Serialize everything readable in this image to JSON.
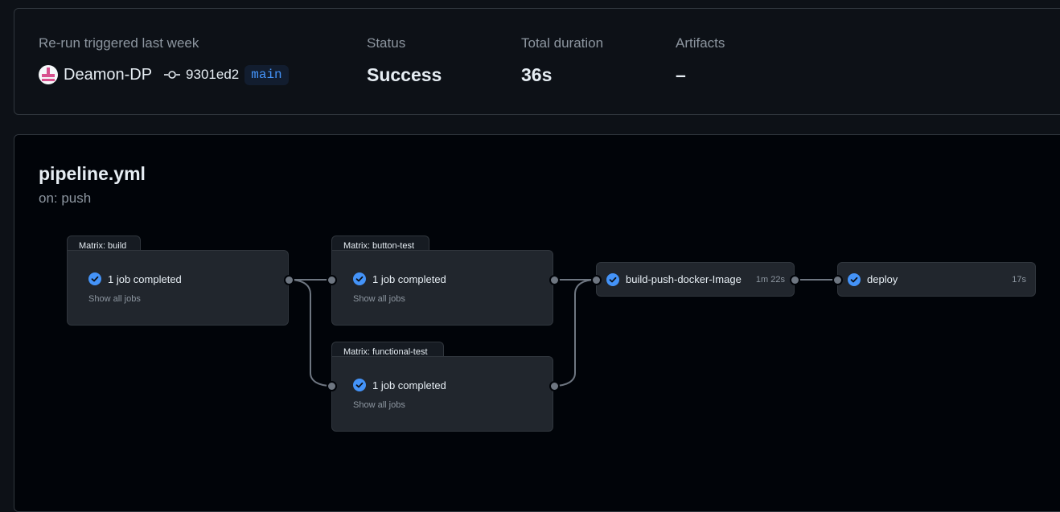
{
  "summary": {
    "trigger_label": "Re-run triggered last week",
    "actor": "Deamon-DP",
    "commit_sha": "9301ed2",
    "branch": "main",
    "status_label": "Status",
    "status_value": "Success",
    "duration_label": "Total duration",
    "duration_value": "36s",
    "artifacts_label": "Artifacts",
    "artifacts_value": "–"
  },
  "workflow": {
    "file": "pipeline.yml",
    "trigger": "on: push"
  },
  "graph": {
    "matrix_build": {
      "tab": "Matrix: build",
      "jobs": "1 job completed",
      "show_all": "Show all jobs"
    },
    "matrix_button_test": {
      "tab": "Matrix: button-test",
      "jobs": "1 job completed",
      "show_all": "Show all jobs"
    },
    "matrix_functional_test": {
      "tab": "Matrix: functional-test",
      "jobs": "1 job completed",
      "show_all": "Show all jobs"
    },
    "job_build_push": {
      "name": "build-push-docker-Image",
      "duration": "1m 22s"
    },
    "job_deploy": {
      "name": "deploy",
      "duration": "17s"
    }
  },
  "colors": {
    "success_check": "#4493f8",
    "branch_text": "#4493f8",
    "connector": "#6e7681"
  },
  "icons": {
    "commit": "git-commit-icon",
    "check": "check-circle-fill-icon"
  }
}
